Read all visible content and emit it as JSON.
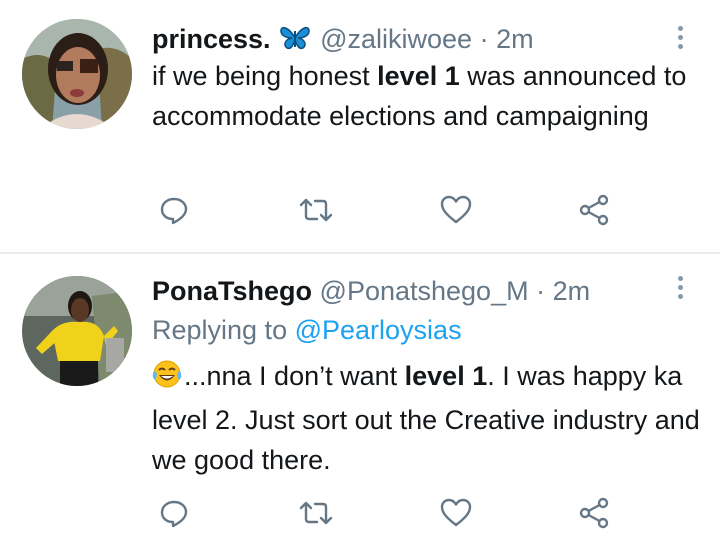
{
  "tweets": [
    {
      "display_name": "princess.",
      "handle": "@zalikiwoee",
      "separator": "·",
      "time": "2m",
      "text_before": "if we being honest ",
      "text_bold": "level 1",
      "text_after": " was announced to accommodate elections and campaigning"
    },
    {
      "display_name": "PonaTshego",
      "handle": "@Ponatshego_M",
      "separator": "·",
      "time": "2m",
      "replying_prefix": "Replying to ",
      "replying_handle": "@Pearloysias",
      "text_before": "...nna I don’t want ",
      "text_bold": "level 1",
      "text_after": ". I was happy ka level 2. Just sort out the Creative industry and we good there."
    }
  ],
  "icons": {
    "name_badge": "butterfly-emoji-icon",
    "emoji": "laughing-tears-emoji-icon",
    "reply": "reply-bubble-icon",
    "retweet": "retweet-icon",
    "like": "heart-icon",
    "share": "share-icon",
    "more": "more-vertical-icon"
  },
  "colors": {
    "text": "#14171a",
    "muted": "#657786",
    "link": "#1da1f2",
    "icon": "#657786",
    "divider": "#e6ecf0"
  }
}
